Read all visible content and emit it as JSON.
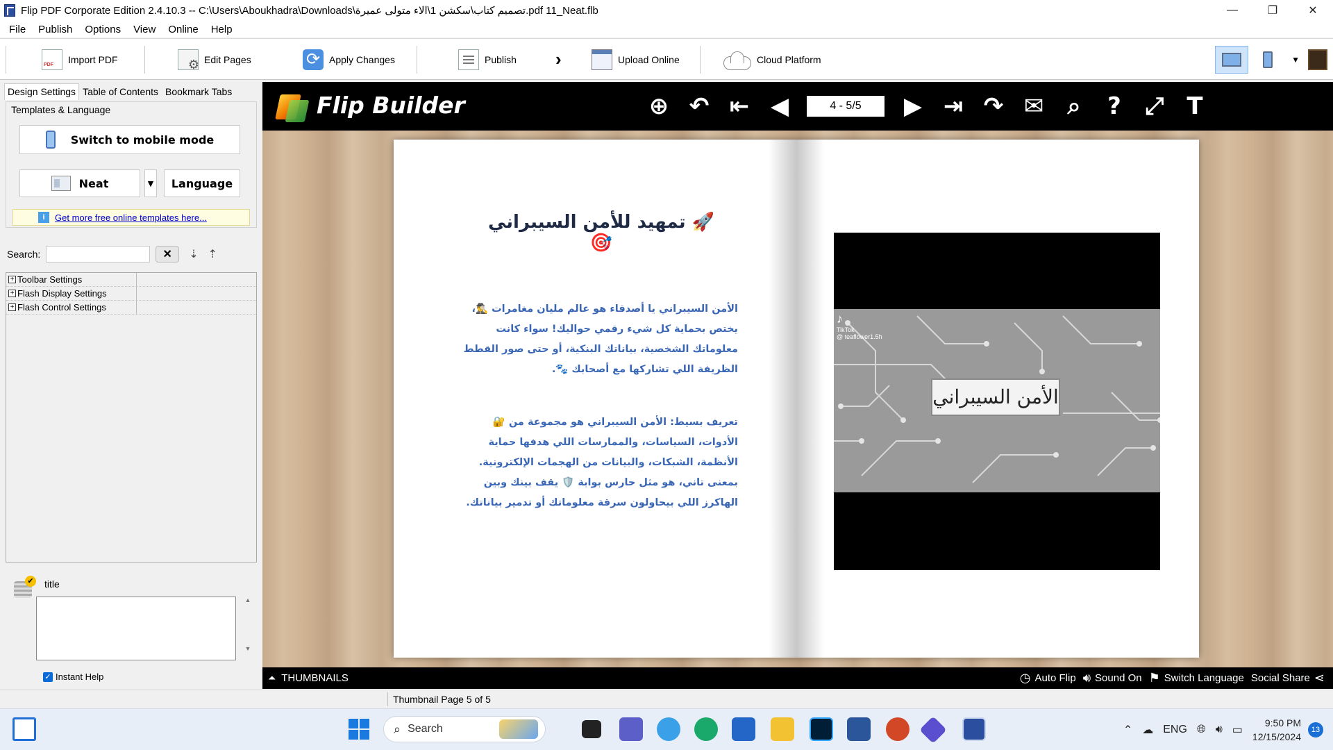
{
  "titlebar": {
    "title": "Flip PDF Corporate Edition 2.4.10.3 -- C:\\Users\\Aboukhadra\\Downloads\\تصميم كتاب\\سكشن 1\\الاء متولى عميرة.pdf 11_Neat.flb",
    "minimize": "—",
    "restore": "❐",
    "close": "✕"
  },
  "menu": [
    "File",
    "Publish",
    "Options",
    "View",
    "Online",
    "Help"
  ],
  "toolbar": {
    "import": "Import PDF",
    "edit": "Edit Pages",
    "apply": "Apply Changes",
    "publish": "Publish",
    "upload": "Upload Online",
    "cloud": "Cloud Platform",
    "dropdown_icon": "chevron-right-icon"
  },
  "left": {
    "tabs": [
      "Design Settings",
      "Table of Contents",
      "Bookmark Tabs"
    ],
    "group_label": "Templates & Language",
    "mobile_btn": "Switch to mobile mode",
    "template_btn": "Neat",
    "language_btn": "Language",
    "link": "Get more free online templates here...",
    "search_label": "Search:",
    "search_value": "",
    "tree": [
      "Toolbar Settings",
      "Flash Display Settings",
      "Flash Control Settings"
    ],
    "help_title": "title",
    "help_text": "",
    "instant_help": "Instant Help"
  },
  "viewer": {
    "brand": "Flip Builder",
    "page_input": "4 - 5/5",
    "icons": [
      "zoom-in-icon",
      "undo-icon",
      "first-page-icon",
      "prev-page-icon",
      "next-page-icon",
      "last-page-icon",
      "redo-icon",
      "email-icon",
      "search-icon",
      "help-icon",
      "fullscreen-icon",
      "text-icon"
    ],
    "bottom": {
      "thumbnails": "THUMBNAILS",
      "auto_flip": "Auto Flip",
      "sound": "Sound On",
      "switch_lang": "Switch Language",
      "social": "Social Share"
    }
  },
  "book": {
    "left_title": "🚀 تمهيد للأمن السيبراني 🎯",
    "para1": "الأمن السيبراني يا أصدقاء هو عالم مليان مغامرات 🕵️‍♂️، يختص بحماية كل شيء رقمي حواليك! سواء كانت معلوماتك الشخصية، بياناتك البنكية، أو حتى صور القطط الظريفة اللي تشاركها مع أصحابك 🐾.",
    "para2": "تعريف بسيط: الأمن السيبراني هو مجموعة من 🔐 الأدوات، السياسات، والممارسات اللي هدفها حماية الأنظمة، الشبكات، والبيانات من الهجمات الإلكترونية. بمعنى تاني، هو مثل حارس بوابة 🛡️ يقف بينك وبين الهاكرز اللي بيحاولون سرقة معلوماتك أو تدمير بياناتك.",
    "image_label": "الأمن السيبراني",
    "tiktok_brand": "TikTok",
    "tiktok_user": "@ teaflower1.5h"
  },
  "status": {
    "text": "Thumbnail Page 5 of 5"
  },
  "taskbar": {
    "search": "Search",
    "lang": "ENG",
    "time": "9:50 PM",
    "date": "12/15/2024",
    "notifications": "13"
  }
}
